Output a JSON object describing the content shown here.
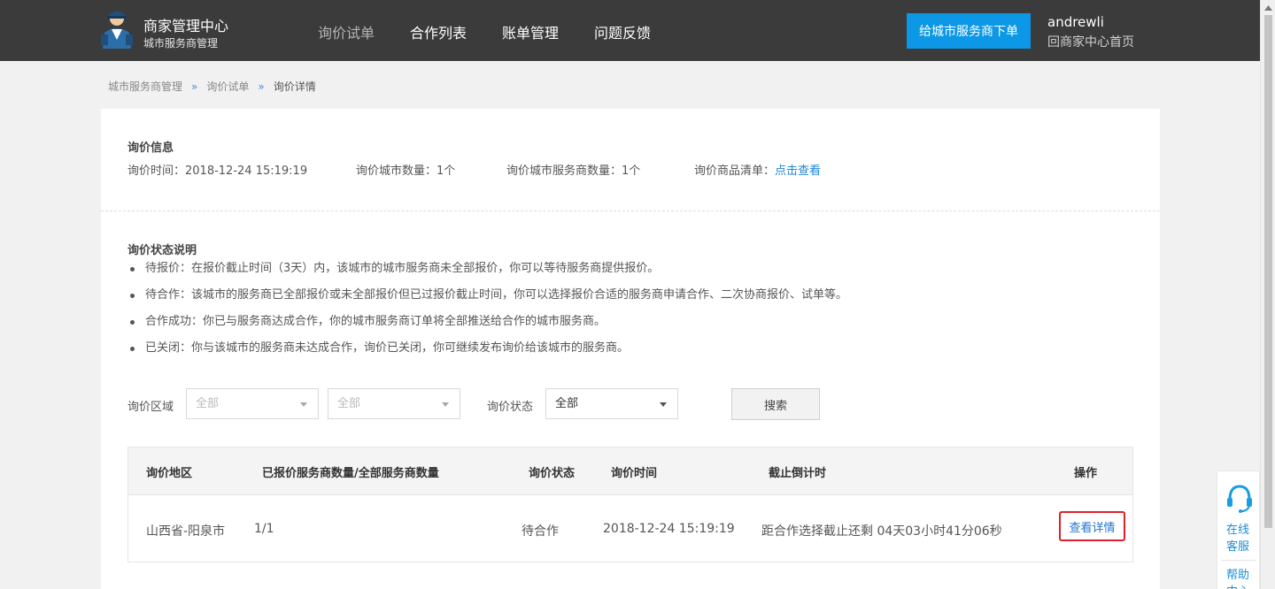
{
  "header": {
    "brand_title": "商家管理中心",
    "brand_subtitle": "城市服务商管理",
    "nav": [
      {
        "label": "询价试单",
        "active": true
      },
      {
        "label": "合作列表",
        "active": false
      },
      {
        "label": "账单管理",
        "active": false
      },
      {
        "label": "问题反馈",
        "active": false
      }
    ],
    "order_button": "给城市服务商下单",
    "user_name": "andrewli",
    "home_link": "回商家中心首页"
  },
  "breadcrumb": {
    "items": [
      "城市服务商管理",
      "询价试单",
      "询价详情"
    ],
    "separator": "»"
  },
  "inquiry_info": {
    "title": "询价信息",
    "time_label": "询价时间：",
    "time_value": "2018-12-24 15:19:19",
    "city_count": "询价城市数量：1个",
    "provider_count": "询价城市服务商数量：1个",
    "goods_label": "询价商品清单：",
    "goods_link": "点击查看"
  },
  "status_desc": {
    "title": "询价状态说明",
    "items": [
      "待报价：在报价截止时间（3天）内，该城市的城市服务商未全部报价，你可以等待服务商提供报价。",
      "待合作：该城市的服务商已全部报价或未全部报价但已过报价截止时间，你可以选择报价合适的服务商申请合作、二次协商报价、试单等。",
      "合作成功：你已与服务商达成合作，你的城市服务商订单将全部推送给合作的城市服务商。",
      "已关闭：你与该城市的服务商未达成合作，询价已关闭，你可继续发布询价给该城市的服务商。"
    ]
  },
  "filters": {
    "region_label": "询价区域",
    "province_value": "全部",
    "city_value": "全部",
    "status_label": "询价状态",
    "status_value": "全部",
    "search_button": "搜索"
  },
  "table": {
    "headers": [
      "询价地区",
      "已报价服务商数量/全部服务商数量",
      "询价状态",
      "询价时间",
      "截止倒计时",
      "操作"
    ],
    "rows": [
      {
        "region": "山西省-阳泉市",
        "quote_ratio": "1/1",
        "status": "待合作",
        "time": "2018-12-24 15:19:19",
        "countdown": "距合作选择截止还剩 04天03小时41分06秒",
        "action": "查看详情"
      }
    ]
  },
  "float_service": {
    "service_line1": "在线",
    "service_line2": "客服",
    "help_line1": "帮助",
    "help_line2": "中心"
  },
  "colors": {
    "header_bg": "#3b3b3b",
    "accent_blue": "#0c98e6",
    "link_blue": "#1f86d8",
    "highlight_red": "#e0202a"
  }
}
